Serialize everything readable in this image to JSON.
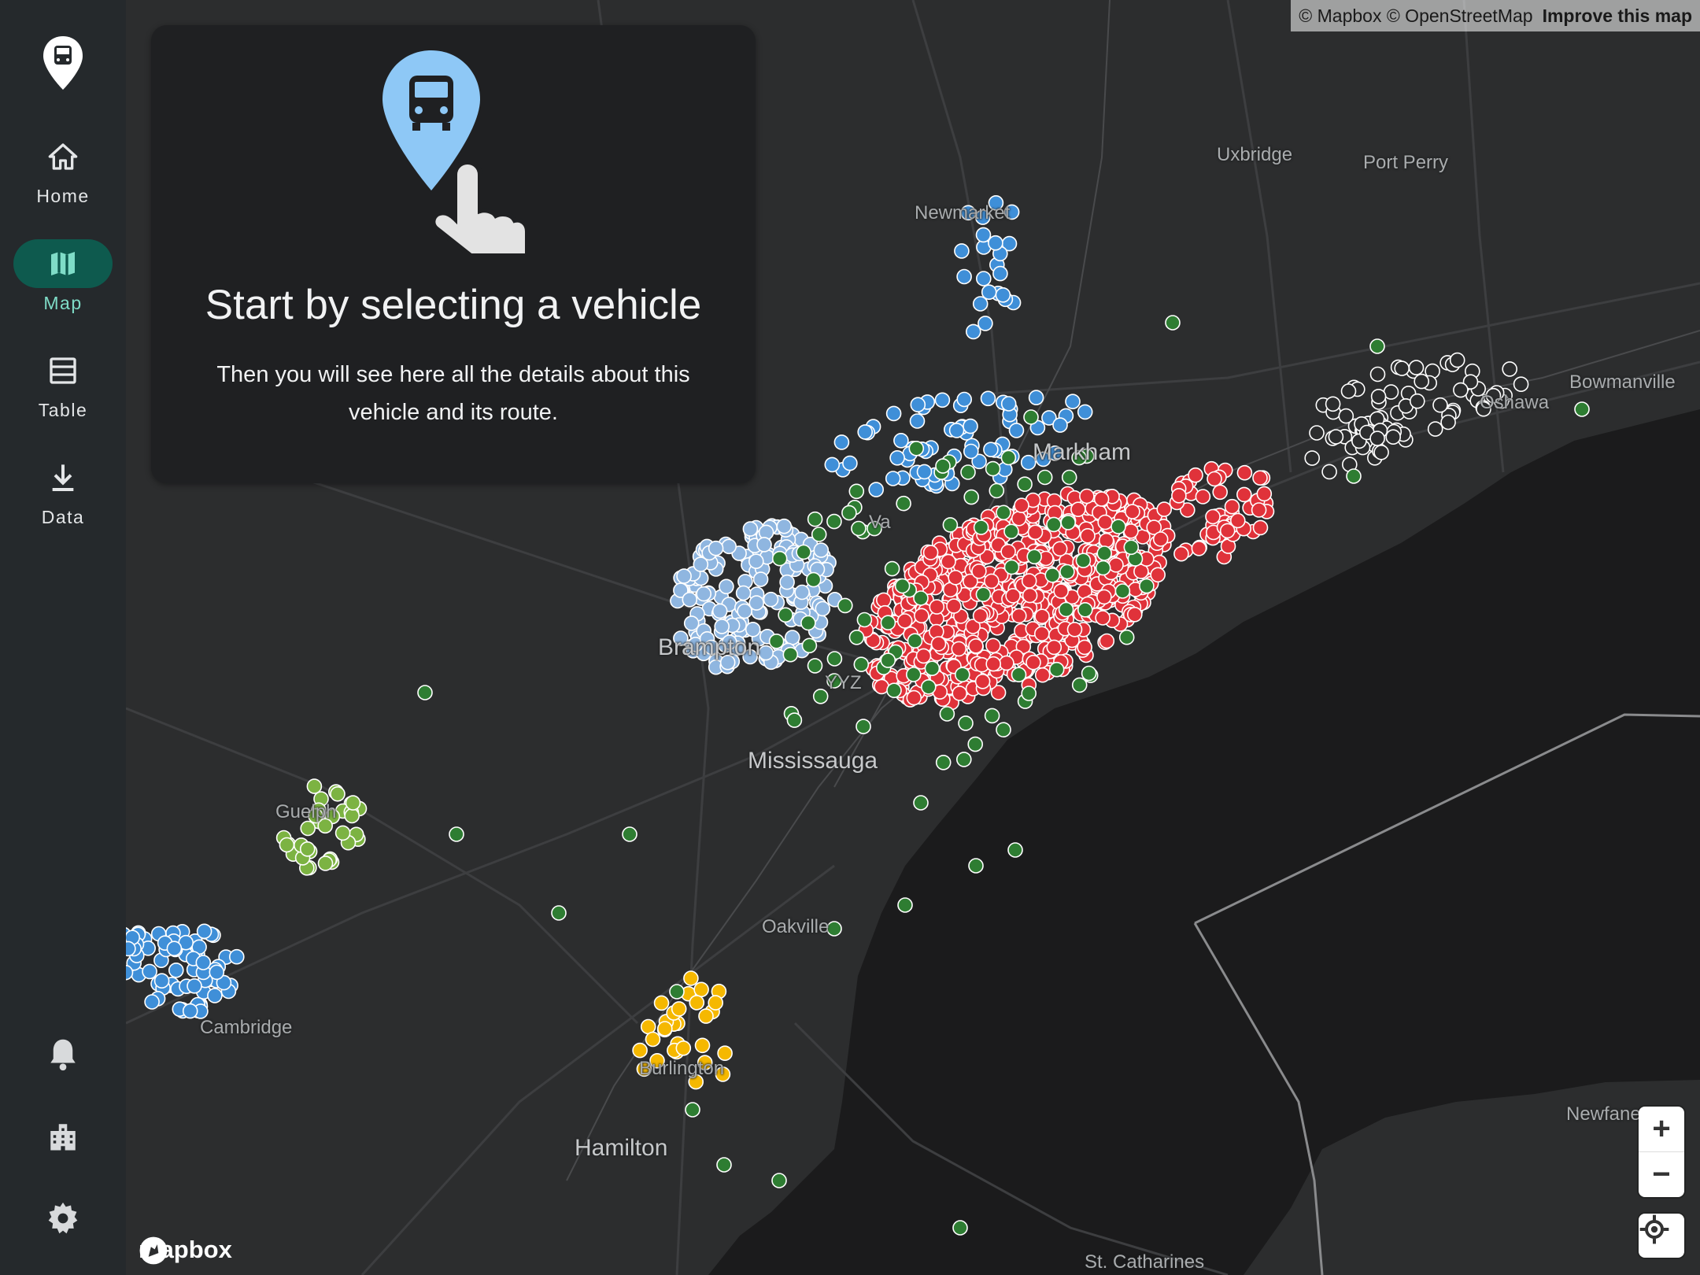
{
  "sidebar": {
    "logo": "bus-marker-logo",
    "nav": [
      {
        "label": "Home",
        "icon": "home-icon",
        "active": false
      },
      {
        "label": "Map",
        "icon": "map-icon",
        "active": true
      },
      {
        "label": "Table",
        "icon": "table-icon",
        "active": false
      },
      {
        "label": "Data",
        "icon": "download-icon",
        "active": false
      }
    ],
    "bottom_icons": [
      "bell-icon",
      "building-icon",
      "gear-icon"
    ]
  },
  "panel": {
    "title": "Start by selecting a vehicle",
    "body": "Then you will see here all the details about this vehicle and its route.",
    "icon": "bus-marker-tap-icon"
  },
  "map": {
    "attribution": "© Mapbox © OpenStreetMap",
    "improve_link": "Improve this map",
    "logo_text": "mapbox",
    "zoom_in": "+",
    "zoom_out": "−",
    "places": {
      "uxbridge": "Uxbridge",
      "port_perry": "Port Perry",
      "newmarket": "Newmarket",
      "bowmanville": "Bowmanville",
      "markham": "Markham",
      "vaughan": "Va",
      "brampton": "Brampton",
      "yyz": "YYZ",
      "mississauga": "Mississauga",
      "guelph": "Guelph",
      "oakville": "Oakville",
      "cambridge": "Cambridge",
      "burlington": "Burlington",
      "hamilton": "Hamilton",
      "newfane": "Newfane",
      "st_catharines": "St. Catharines",
      "oshawa": "Oshawa"
    }
  },
  "colors": {
    "sidebar_bg": "#25292c",
    "active_pill": "#0e5a4e",
    "active_text": "#7fdcc7",
    "panel_bg": "#1f2022",
    "vehicle_red": "#e0323a",
    "vehicle_blue": "#3f8fd8",
    "vehicle_lightblue": "#8fb6e0",
    "vehicle_green": "#2e7d32",
    "vehicle_lightgreen": "#7cb342",
    "vehicle_yellow": "#f5b800",
    "vehicle_white": "#2c2d2e",
    "lake": "#1b1b1c"
  }
}
